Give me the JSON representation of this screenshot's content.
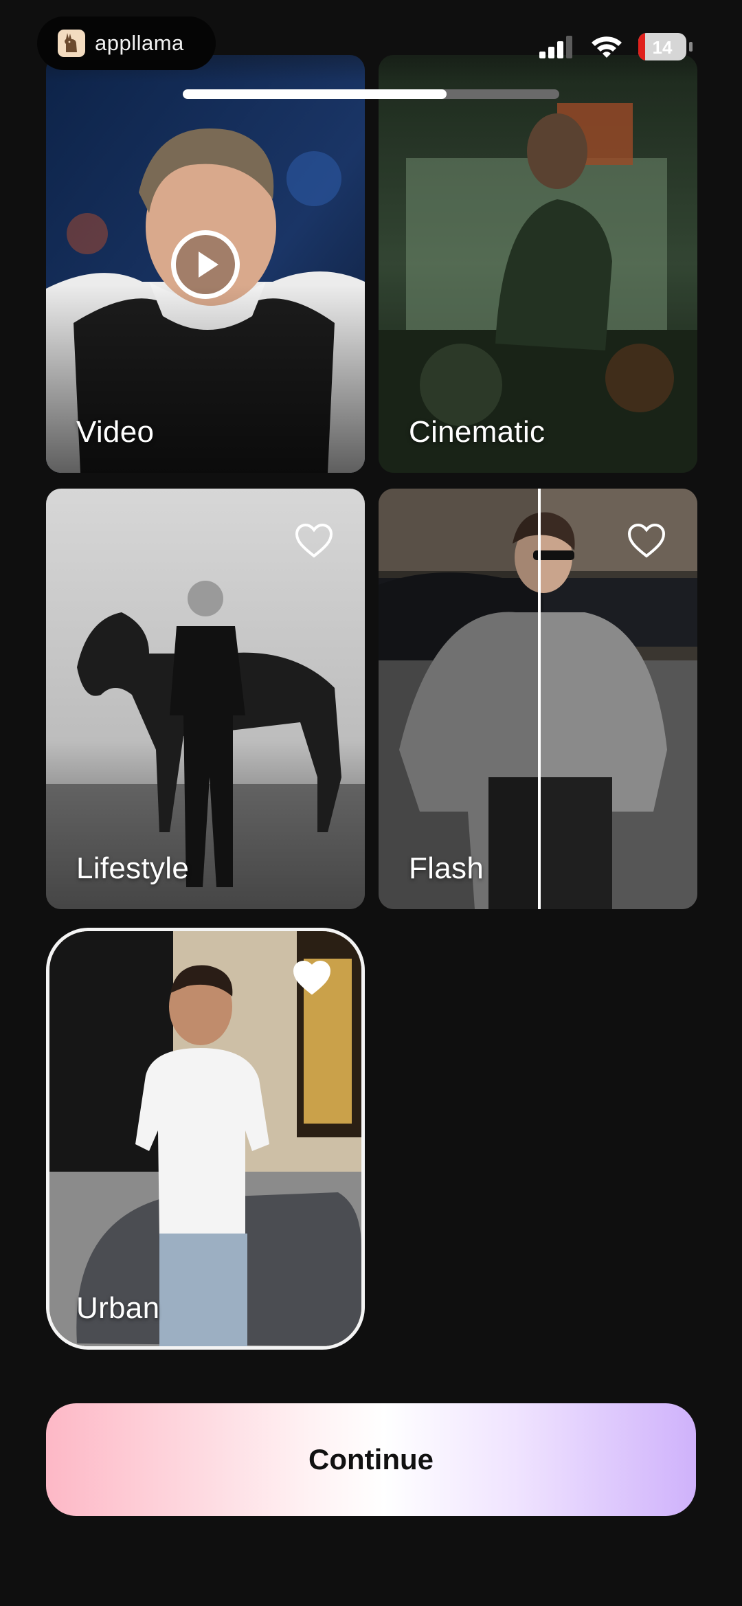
{
  "app": {
    "brand_name": "appllama"
  },
  "status_bar": {
    "battery_level": "14",
    "battery_fraction": 0.14
  },
  "progress": {
    "fraction": 0.7
  },
  "styles": [
    {
      "label": "Video",
      "favorite": false,
      "selected": false,
      "has_play": true
    },
    {
      "label": "Cinematic",
      "favorite": false,
      "selected": false
    },
    {
      "label": "Lifestyle",
      "favorite": false,
      "selected": false
    },
    {
      "label": "Flash",
      "favorite": false,
      "selected": false
    },
    {
      "label": "Urban",
      "favorite": true,
      "selected": true
    }
  ],
  "actions": {
    "continue_label": "Continue"
  },
  "colors": {
    "background": "#0f0f0f",
    "accent_pink": "#fdb8c6",
    "accent_purple": "#cfb2fb"
  }
}
